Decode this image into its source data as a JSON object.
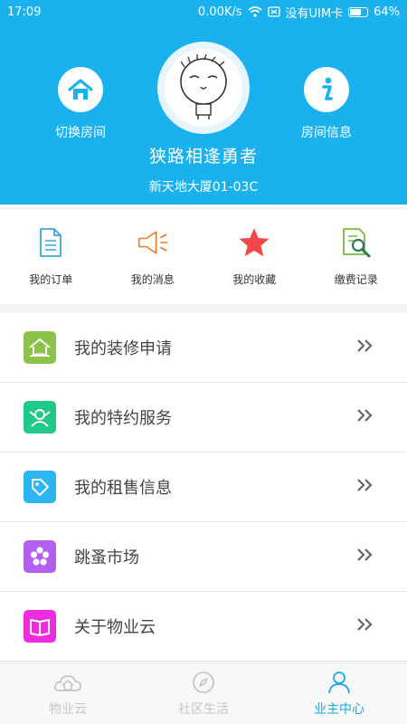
{
  "status_bar": {
    "time": "17:09",
    "speed": "0.00K/s",
    "carrier": "没有UIM卡",
    "battery": "64%"
  },
  "header": {
    "left_action": {
      "label": "切换房间",
      "icon": "home-icon"
    },
    "right_action": {
      "label": "房间信息",
      "icon": "info-icon"
    },
    "username": "狭路相逢勇者",
    "address": "新天地大厦01-03C"
  },
  "quick_grid": [
    {
      "label": "我的订单",
      "icon": "document-icon"
    },
    {
      "label": "我的消息",
      "icon": "megaphone-icon"
    },
    {
      "label": "我的收藏",
      "icon": "star-icon"
    },
    {
      "label": "缴费记录",
      "icon": "search-document-icon"
    }
  ],
  "menu": [
    {
      "label": "我的装修申请",
      "icon": "house-icon",
      "color": "#8bc34a"
    },
    {
      "label": "我的特约服务",
      "icon": "service-icon",
      "color": "#1ec98a"
    },
    {
      "label": "我的租售信息",
      "icon": "tag-icon",
      "color": "#2cb5f0"
    },
    {
      "label": "跳蚤市场",
      "icon": "flower-icon",
      "color": "#b45ff0"
    },
    {
      "label": "关于物业云",
      "icon": "book-icon",
      "color": "#f02ce0"
    }
  ],
  "tab_bar": [
    {
      "label": "物业云",
      "icon": "cloud-house-icon",
      "active": false
    },
    {
      "label": "社区生活",
      "icon": "compass-icon",
      "active": false
    },
    {
      "label": "业主中心",
      "icon": "user-icon",
      "active": true
    }
  ]
}
